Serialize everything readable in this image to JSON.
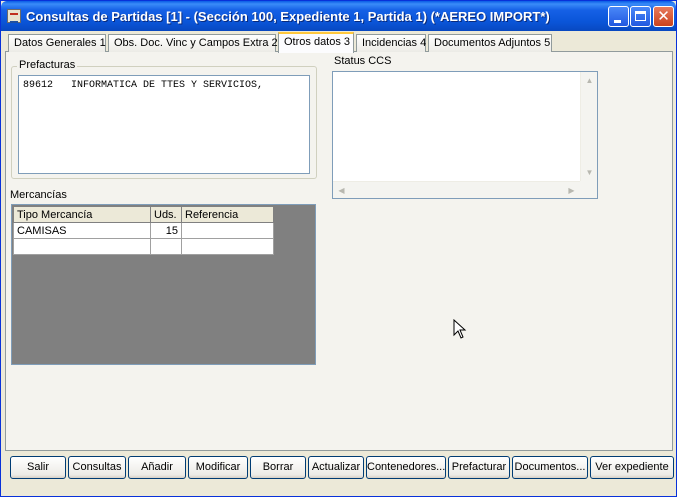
{
  "window": {
    "title": "Consultas de Partidas [1] - (Sección 100, Expediente 1, Partida 1) (*AEREO IMPORT*)",
    "icon": "app-form-icon"
  },
  "tabs": [
    {
      "label": "Datos Generales 1"
    },
    {
      "label": "Obs. Doc. Vinc y Campos Extra 2"
    },
    {
      "label": "Otros datos 3"
    },
    {
      "label": "Incidencias 4"
    },
    {
      "label": "Documentos Adjuntos 5"
    }
  ],
  "active_tab": "Otros datos 3",
  "prefacturas": {
    "label": "Prefacturas",
    "lines": [
      "89612   INFORMATICA DE TTES Y SERVICIOS,"
    ]
  },
  "status_ccs": {
    "label": "Status CCS",
    "text": ""
  },
  "mercancias": {
    "label": "Mercancías",
    "columns": [
      "Tipo Mercancía",
      "Uds.",
      "Referencia"
    ],
    "rows": [
      [
        "CAMISAS",
        "15",
        ""
      ],
      [
        "",
        "",
        ""
      ]
    ]
  },
  "buttons": [
    {
      "label": "Salir"
    },
    {
      "label": "Consultas"
    },
    {
      "label": "Añadir"
    },
    {
      "label": "Modificar"
    },
    {
      "label": "Borrar"
    },
    {
      "label": "Actualizar"
    },
    {
      "label": "Contenedores..."
    },
    {
      "label": "Prefacturar"
    },
    {
      "label": "Documentos..."
    },
    {
      "label": "Ver expediente"
    }
  ],
  "colors": {
    "titlebar": "#0a55d8",
    "window_bg": "#ece9d8",
    "grid_bg": "#808080",
    "active_tab_accent": "#ffc83c"
  }
}
